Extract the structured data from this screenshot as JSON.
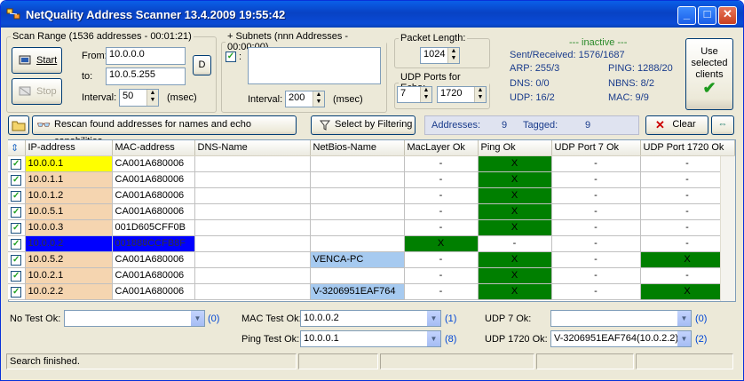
{
  "window": {
    "title": "NetQuality Address Scanner 13.4.2009 19:55:42"
  },
  "scan_range": {
    "legend": "Scan Range (1536 addresses - 00:01:21)",
    "start_label": "Start",
    "stop_label": "Stop",
    "from_label": "From:",
    "from_value": "10.0.0.0",
    "to_label": "to:",
    "to_value": "10.0.5.255",
    "d_label": "D",
    "interval_label": "Interval:",
    "interval_value": "50",
    "interval_unit": "(msec)"
  },
  "subnets": {
    "legend": "+ Subnets (nnn Addresses - 00:00:00)",
    "colon": ":",
    "interval_label": "Interval:",
    "interval_value": "200",
    "interval_unit": "(msec)"
  },
  "packet": {
    "legend": "Packet Length:",
    "value": "1024"
  },
  "udp_ports": {
    "legend": "UDP Ports for Echo:",
    "port1": "7",
    "port2": "1720"
  },
  "status": {
    "state": "--- inactive ---",
    "sent_received": "Sent/Received: 1576/1687",
    "arp": "ARP: 255/3",
    "ping": "PING: 1288/20",
    "dns": "DNS: 0/0",
    "nbns": "NBNS: 8/2",
    "udp": "UDP: 16/2",
    "mac": "MAC: 9/9"
  },
  "use_selected": {
    "line1": "Use",
    "line2": "selected",
    "line3": "clients"
  },
  "toolbar": {
    "rescan_label": "Rescan found addresses for names and echo capabilities",
    "filter_label": "Select by Filtering",
    "addresses_label": "Addresses:",
    "addresses_count": "9",
    "tagged_label": "Tagged:",
    "tagged_count": "9",
    "clear_label": "Clear"
  },
  "table": {
    "columns": [
      "IP-address",
      "MAC-address",
      "DNS-Name",
      "NetBios-Name",
      "MacLayer Ok",
      "Ping Ok",
      "UDP Port 7 Ok",
      "UDP Port 1720 Ok"
    ],
    "rows": [
      {
        "ip": "10.0.0.1",
        "mac": "CA001A680006",
        "dns": "",
        "netbios": "",
        "maclayer": "-",
        "ping": "X",
        "udp7": "-",
        "udp1720": "-"
      },
      {
        "ip": "10.0.1.1",
        "mac": "CA001A680006",
        "dns": "",
        "netbios": "",
        "maclayer": "-",
        "ping": "X",
        "udp7": "-",
        "udp1720": "-"
      },
      {
        "ip": "10.0.1.2",
        "mac": "CA001A680006",
        "dns": "",
        "netbios": "",
        "maclayer": "-",
        "ping": "X",
        "udp7": "-",
        "udp1720": "-"
      },
      {
        "ip": "10.0.5.1",
        "mac": "CA001A680006",
        "dns": "",
        "netbios": "",
        "maclayer": "-",
        "ping": "X",
        "udp7": "-",
        "udp1720": "-"
      },
      {
        "ip": "10.0.0.3",
        "mac": "001D605CFF0B",
        "dns": "",
        "netbios": "",
        "maclayer": "-",
        "ping": "X",
        "udp7": "-",
        "udp1720": "-"
      },
      {
        "ip": "10.0.0.2",
        "mac": "001888CCFB8F",
        "dns": "",
        "netbios": "",
        "maclayer": "X",
        "ping": "-",
        "udp7": "-",
        "udp1720": "-"
      },
      {
        "ip": "10.0.5.2",
        "mac": "CA001A680006",
        "dns": "",
        "netbios": "VENCA-PC",
        "maclayer": "-",
        "ping": "X",
        "udp7": "-",
        "udp1720": "X"
      },
      {
        "ip": "10.0.2.1",
        "mac": "CA001A680006",
        "dns": "",
        "netbios": "",
        "maclayer": "-",
        "ping": "X",
        "udp7": "-",
        "udp1720": "-"
      },
      {
        "ip": "10.0.2.2",
        "mac": "CA001A680006",
        "dns": "",
        "netbios": "V-3206951EAF764",
        "maclayer": "-",
        "ping": "X",
        "udp7": "-",
        "udp1720": "X"
      }
    ]
  },
  "bottom": {
    "no_test_label": "No Test Ok:",
    "no_test_value": "",
    "no_test_count": "(0)",
    "mac_test_label": "MAC Test Ok:",
    "mac_test_value": "10.0.0.2",
    "mac_test_count": "(1)",
    "ping_test_label": "Ping Test Ok:",
    "ping_test_value": "10.0.0.1",
    "ping_test_count": "(8)",
    "udp7_label": "UDP 7 Ok:",
    "udp7_value": "",
    "udp7_count": "(0)",
    "udp1720_label": "UDP 1720 Ok:",
    "udp1720_value": "V-3206951EAF764(10.0.2.2)",
    "udp1720_count": "(2)"
  },
  "statusbar": {
    "text": "Search finished."
  },
  "colors": {
    "ping_ok": "#007f00",
    "ip_first": "#ffff00",
    "ip_selected": "#0000ff",
    "ip_default": "#f5d5b0",
    "netbios_bg": "#a6caf0"
  }
}
